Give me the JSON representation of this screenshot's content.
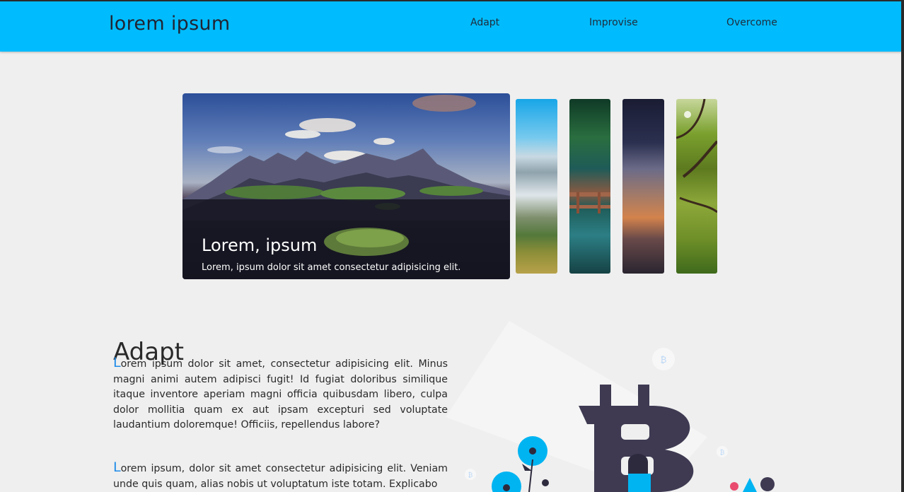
{
  "header": {
    "brand": "lorem ipsum",
    "nav": [
      "Adapt",
      "Improvise",
      "Overcome"
    ]
  },
  "gallery": {
    "featured": {
      "title": "Lorem, ipsum",
      "caption": "Lorem, ipsum dolor sit amet consectetur adipisicing elit.",
      "image": "mountain-landscape-photo"
    },
    "thumbnails": [
      "coastal-fog-photo",
      "forest-bridge-photo",
      "milky-way-photo",
      "green-tree-photo"
    ]
  },
  "section": {
    "heading": "Adapt",
    "paragraphs": [
      {
        "initial": "L",
        "rest": "orem ipsum dolor sit amet, consectetur adipisicing elit. Minus magni animi autem adipisci fugit! Id fugiat doloribus similique itaque inventore aperiam magni officia quibusdam libero, culpa dolor mollitia quam ex aut ipsam excepturi sed voluptate laudantium doloremque! Officiis, repellendus labore?"
      },
      {
        "initial": "L",
        "rest": "orem ipsum, dolor sit amet consectetur adipisicing elit. Veniam unde quis quam, alias nobis ut voluptatum iste totam. Explicabo"
      }
    ],
    "illustration": "bitcoin-illustration"
  },
  "colors": {
    "header_bg": "#00bcff",
    "page_bg": "#efefef",
    "accent": "#1f8be8",
    "illustration_dark": "#3f3a52"
  }
}
